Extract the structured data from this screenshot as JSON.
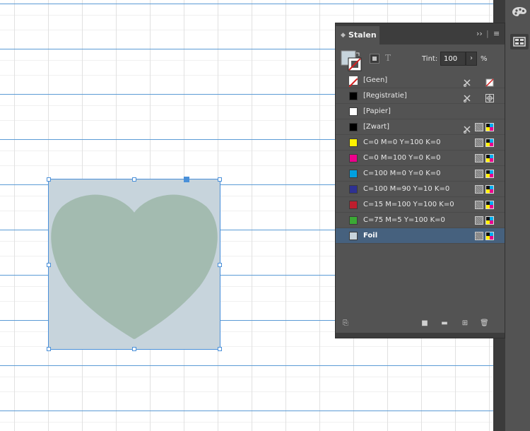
{
  "panel": {
    "title": "Stalen",
    "tint_label": "Tint:",
    "tint_value": "100",
    "tint_unit": "%",
    "fill_color": "#c7d4dc"
  },
  "swatches": [
    {
      "name": "[Geen]",
      "color": "none",
      "icons": [
        "scissors-lock-icon",
        "none-icon"
      ],
      "selected": false
    },
    {
      "name": "[Registratie]",
      "color": "#000000",
      "icons": [
        "scissors-lock-icon",
        "registration-icon"
      ],
      "selected": false
    },
    {
      "name": "[Papier]",
      "color": "#ffffff",
      "icons": [],
      "selected": false
    },
    {
      "name": "[Zwart]",
      "color": "#000000",
      "icons": [
        "scissors-lock-icon",
        "process-icon",
        "cmyk-icon"
      ],
      "selected": false
    },
    {
      "name": "C=0 M=0 Y=100 K=0",
      "color": "#fff200",
      "icons": [
        "process-icon",
        "cmyk-icon"
      ],
      "selected": false
    },
    {
      "name": "C=0 M=100 Y=0 K=0",
      "color": "#ec008c",
      "icons": [
        "process-icon",
        "cmyk-icon"
      ],
      "selected": false
    },
    {
      "name": "C=100 M=0 Y=0 K=0",
      "color": "#00a0df",
      "icons": [
        "process-icon",
        "cmyk-icon"
      ],
      "selected": false
    },
    {
      "name": "C=100 M=90 Y=10 K=0",
      "color": "#2e3192",
      "icons": [
        "process-icon",
        "cmyk-icon"
      ],
      "selected": false
    },
    {
      "name": "C=15 M=100 Y=100 K=0",
      "color": "#be1e2d",
      "icons": [
        "process-icon",
        "cmyk-icon"
      ],
      "selected": false
    },
    {
      "name": "C=75 M=5 Y=100 K=0",
      "color": "#3ba935",
      "icons": [
        "process-icon",
        "cmyk-icon"
      ],
      "selected": false
    },
    {
      "name": "Foil",
      "color": "#c7d4dc",
      "icons": [
        "process-icon",
        "cmyk-icon"
      ],
      "selected": true
    }
  ],
  "canvas": {
    "frame_color": "#c7d4dc",
    "heart_color": "#a3bbb0",
    "guide_color": "#5b9bd5"
  }
}
